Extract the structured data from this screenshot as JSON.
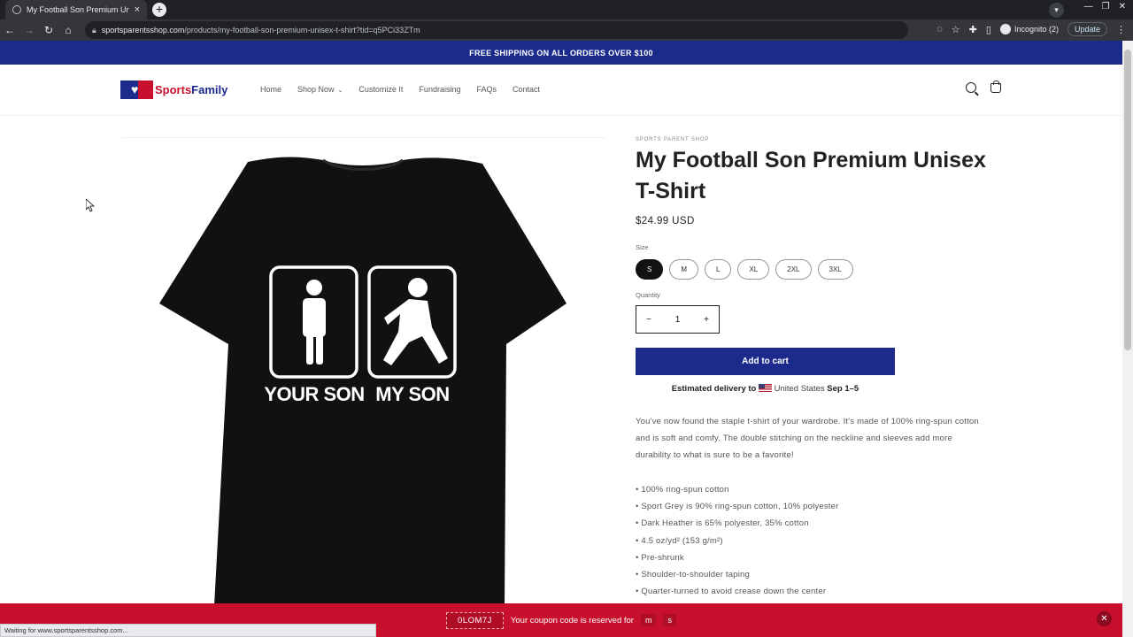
{
  "browser": {
    "tab_title": "My Football Son Premium Unise",
    "url_domain": "sportsparentsshop.com",
    "url_path": "/products/my-football-son-premium-unisex-t-shirt?tid=q5PCi33ZTm",
    "incognito_label": "Incognito (2)",
    "update_label": "Update",
    "status_text": "Waiting for www.sportsparentsshop.com..."
  },
  "announcement": "FREE SHIPPING ON ALL ORDERS OVER $100",
  "header": {
    "logo_sports": "Sports",
    "logo_family": "Family",
    "nav": [
      "Home",
      "Shop Now",
      "Customize It",
      "Fundraising",
      "FAQs",
      "Contact"
    ]
  },
  "product": {
    "vendor": "SPORTS PARENT SHOP",
    "title": "My Football Son Premium Unisex T-Shirt",
    "price": "$24.99 USD",
    "size_label": "Size",
    "sizes": [
      "S",
      "M",
      "L",
      "XL",
      "2XL",
      "3XL"
    ],
    "selected_size": "S",
    "quantity_label": "Quantity",
    "quantity": "1",
    "add_to_cart": "Add to cart",
    "delivery_prefix": "Estimated delivery to",
    "delivery_country": "United States",
    "delivery_dates": "Sep 1–5",
    "description": "You've now found the staple t-shirt of your wardrobe. It's made of 100% ring-spun cotton and is soft and comfy. The double stitching on the neckline and sleeves add more durability to what is sure to be a favorite!",
    "bullets": [
      "• 100% ring-spun cotton",
      "• Sport Grey is 90% ring-spun cotton, 10% polyester",
      "• Dark Heather is 65% polyester, 35% cotton",
      "• 4.5 oz/yd² (153 g/m²)",
      "• Pre-shrunk",
      "• Shoulder-to-shoulder taping",
      "• Quarter-turned to avoid crease down the center"
    ],
    "shirt_text_left": "YOUR SON",
    "shirt_text_right": "MY SON"
  },
  "coupon": {
    "code": "0LOM7J",
    "message": "Your coupon code is reserved for",
    "minutes": "m",
    "seconds": "s"
  },
  "colors": {
    "brand_blue": "#1c2a8c",
    "brand_red": "#c8102e"
  }
}
